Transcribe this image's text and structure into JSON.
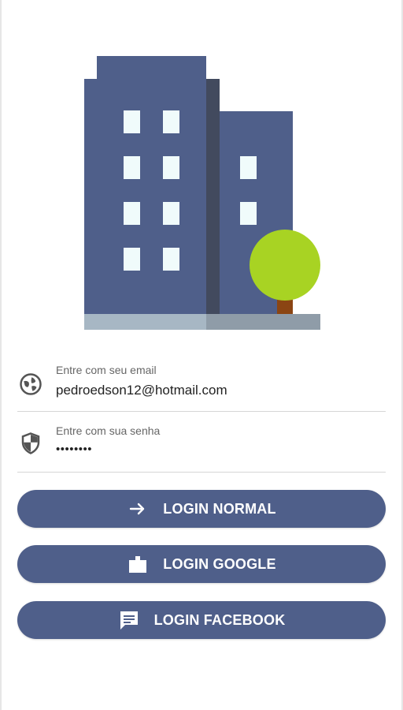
{
  "login_form": {
    "email": {
      "label": "Entre com seu email",
      "value": "pedroedson12@hotmail.com",
      "icon": "globe-icon"
    },
    "password": {
      "label": "Entre com sua senha",
      "value": "••••••••",
      "icon": "shield-icon"
    }
  },
  "buttons": {
    "normal": {
      "label": "LOGIN NORMAL",
      "icon": "arrow-right-icon"
    },
    "google": {
      "label": "LOGIN GOOGLE",
      "icon": "folder-icon"
    },
    "facebook": {
      "label": "LOGIN FACEBOOK",
      "icon": "message-icon"
    }
  },
  "colors": {
    "accent": "#4f5f8a",
    "building": "#4f5f8a",
    "building_shadow": "#424a5e",
    "window": "#f0fbfb",
    "tree": "#a8d323",
    "trunk": "#8b4513",
    "ground": "#a7b7c4"
  }
}
